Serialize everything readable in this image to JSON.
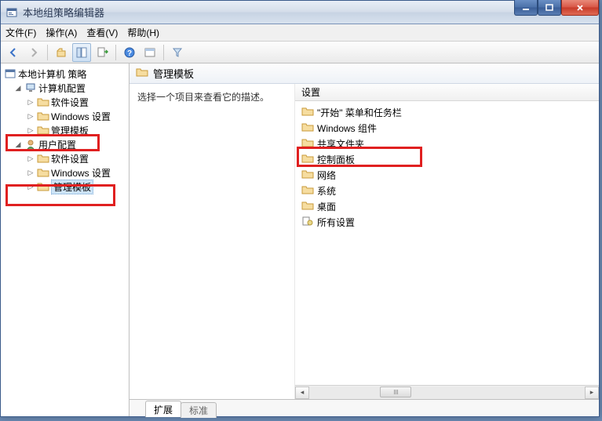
{
  "title": "本地组策略编辑器",
  "menu": {
    "file": "文件(F)",
    "action": "操作(A)",
    "view": "查看(V)",
    "help": "帮助(H)"
  },
  "tree": {
    "root": "本地计算机 策略",
    "computer_config": "计算机配置",
    "software_settings": "软件设置",
    "windows_settings": "Windows 设置",
    "admin_templates": "管理模板",
    "user_config": "用户配置"
  },
  "detail": {
    "header": "管理模板",
    "desc_prompt": "选择一个项目来查看它的描述。",
    "col_setting": "设置"
  },
  "settings_list": [
    "\"开始\" 菜单和任务栏",
    "Windows 组件",
    "共享文件夹",
    "控制面板",
    "网络",
    "系统",
    "桌面",
    "所有设置"
  ],
  "tabs": {
    "extended": "扩展",
    "standard": "标准"
  }
}
